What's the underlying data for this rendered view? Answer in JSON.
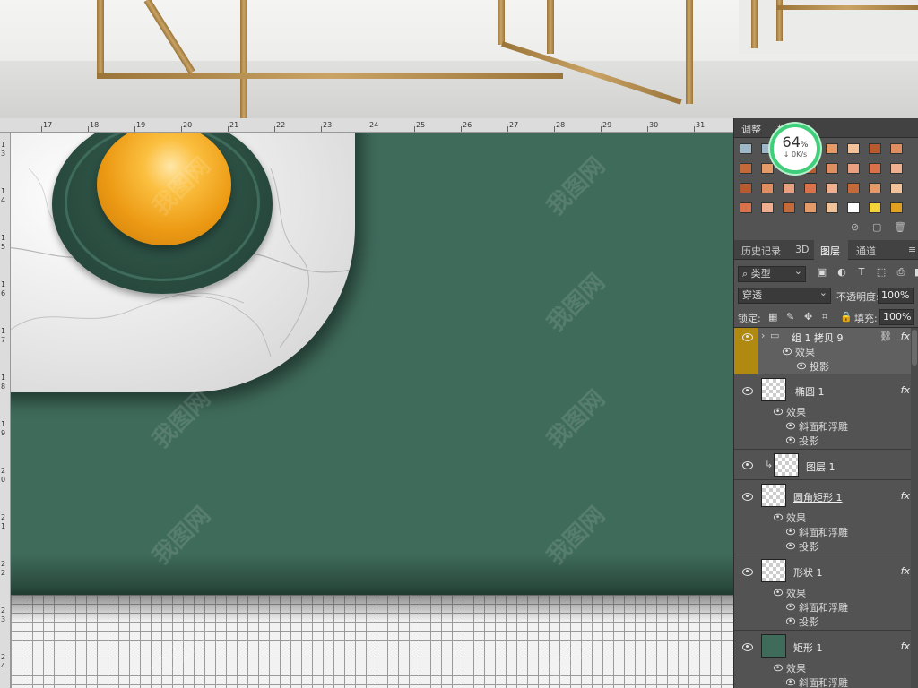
{
  "ruler": {
    "top_labels": [
      "17",
      "18",
      "19",
      "20",
      "21",
      "22",
      "23",
      "24",
      "25",
      "26",
      "27",
      "28",
      "29",
      "30",
      "31"
    ],
    "left_labels": [
      "1",
      "3",
      "1",
      "4",
      "1",
      "5",
      "1",
      "6",
      "1",
      "7",
      "1",
      "8",
      "1",
      "9",
      "2",
      "0",
      "2",
      "1",
      "2",
      "2",
      "2",
      "3",
      "2",
      "4"
    ]
  },
  "watermark": "我图网",
  "panel_top": {
    "tabs": [
      "调整",
      "样式"
    ],
    "badge": {
      "percent": "64",
      "percent_sign": "%",
      "speed": "0K/s"
    }
  },
  "layers_panel": {
    "tabs": [
      "历史记录",
      "3D",
      "图层",
      "通道"
    ],
    "active_tab": "图层",
    "filter_kind": "类型",
    "blend_mode": "穿透",
    "opacity_label": "不透明度:",
    "opacity_value": "100%",
    "lock_label": "锁定:",
    "fill_label": "填充:",
    "fill_value": "100%",
    "layers": [
      {
        "name": "组 1 拷贝 9",
        "type": "group",
        "fx": "fx",
        "effects_label": "效果",
        "effects": [
          "投影"
        ],
        "selected": true
      },
      {
        "name": "椭圆 1",
        "type": "shape",
        "fx": "fx",
        "effects_label": "效果",
        "effects": [
          "斜面和浮雕",
          "投影"
        ]
      },
      {
        "name": "图层 1",
        "type": "pixel"
      },
      {
        "name": "圆角矩形 1",
        "type": "shape",
        "fx": "fx",
        "effects_label": "效果",
        "effects": [
          "斜面和浮雕",
          "投影"
        ]
      },
      {
        "name": "形状 1",
        "type": "shape",
        "fx": "fx",
        "effects_label": "效果",
        "effects": [
          "斜面和浮雕",
          "投影"
        ]
      },
      {
        "name": "矩形 1",
        "type": "shape",
        "fx": "fx",
        "effects_label": "效果",
        "effects": [
          "斜面和浮雕"
        ]
      }
    ]
  },
  "colors": {
    "canvas_green": "#3f6b5b",
    "ball_orange": "#f0a020",
    "selected_layer_eye_bg": "#b08a10",
    "badge_green": "#3fcf7a"
  }
}
